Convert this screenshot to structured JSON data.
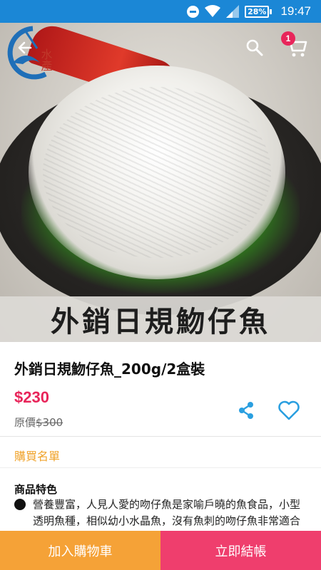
{
  "status_bar": {
    "battery": "28%",
    "time": "19:47",
    "icons": [
      "do-not-disturb-icon",
      "wifi-icon",
      "cell-signal-icon",
      "battery-icon"
    ]
  },
  "header": {
    "logo_text": "水產",
    "cart_count": "1",
    "icons": [
      "back-arrow-icon",
      "search-icon",
      "cart-icon"
    ]
  },
  "hero": {
    "caption": "外銷日規魩仔魚"
  },
  "product": {
    "title": "外銷日規魩仔魚_200g/2盒裝",
    "price": "$230",
    "original_price_label": "原價",
    "original_price": "$300"
  },
  "actions": {
    "purchase_list_label": "購買名單"
  },
  "features": {
    "heading": "商品特色",
    "text": "營養豐富，人見人愛的吻仔魚是家喻戶曉的魚食品，小型透明魚種，相似幼小水晶魚，沒有魚刺的吻仔魚非常適合幼兒及老人食用，吻仔魚美味，富含蛋白質"
  },
  "bottom_bar": {
    "add_to_cart": "加入購物車",
    "checkout": "立即結帳"
  },
  "colors": {
    "status_bar": "#1b87d6",
    "price": "#e8255a",
    "accent_icon": "#2a9fe0",
    "purchase_list": "#f0a32b",
    "add_to_cart_bg": "#f5a237",
    "checkout_bg": "#ef3e6d"
  }
}
